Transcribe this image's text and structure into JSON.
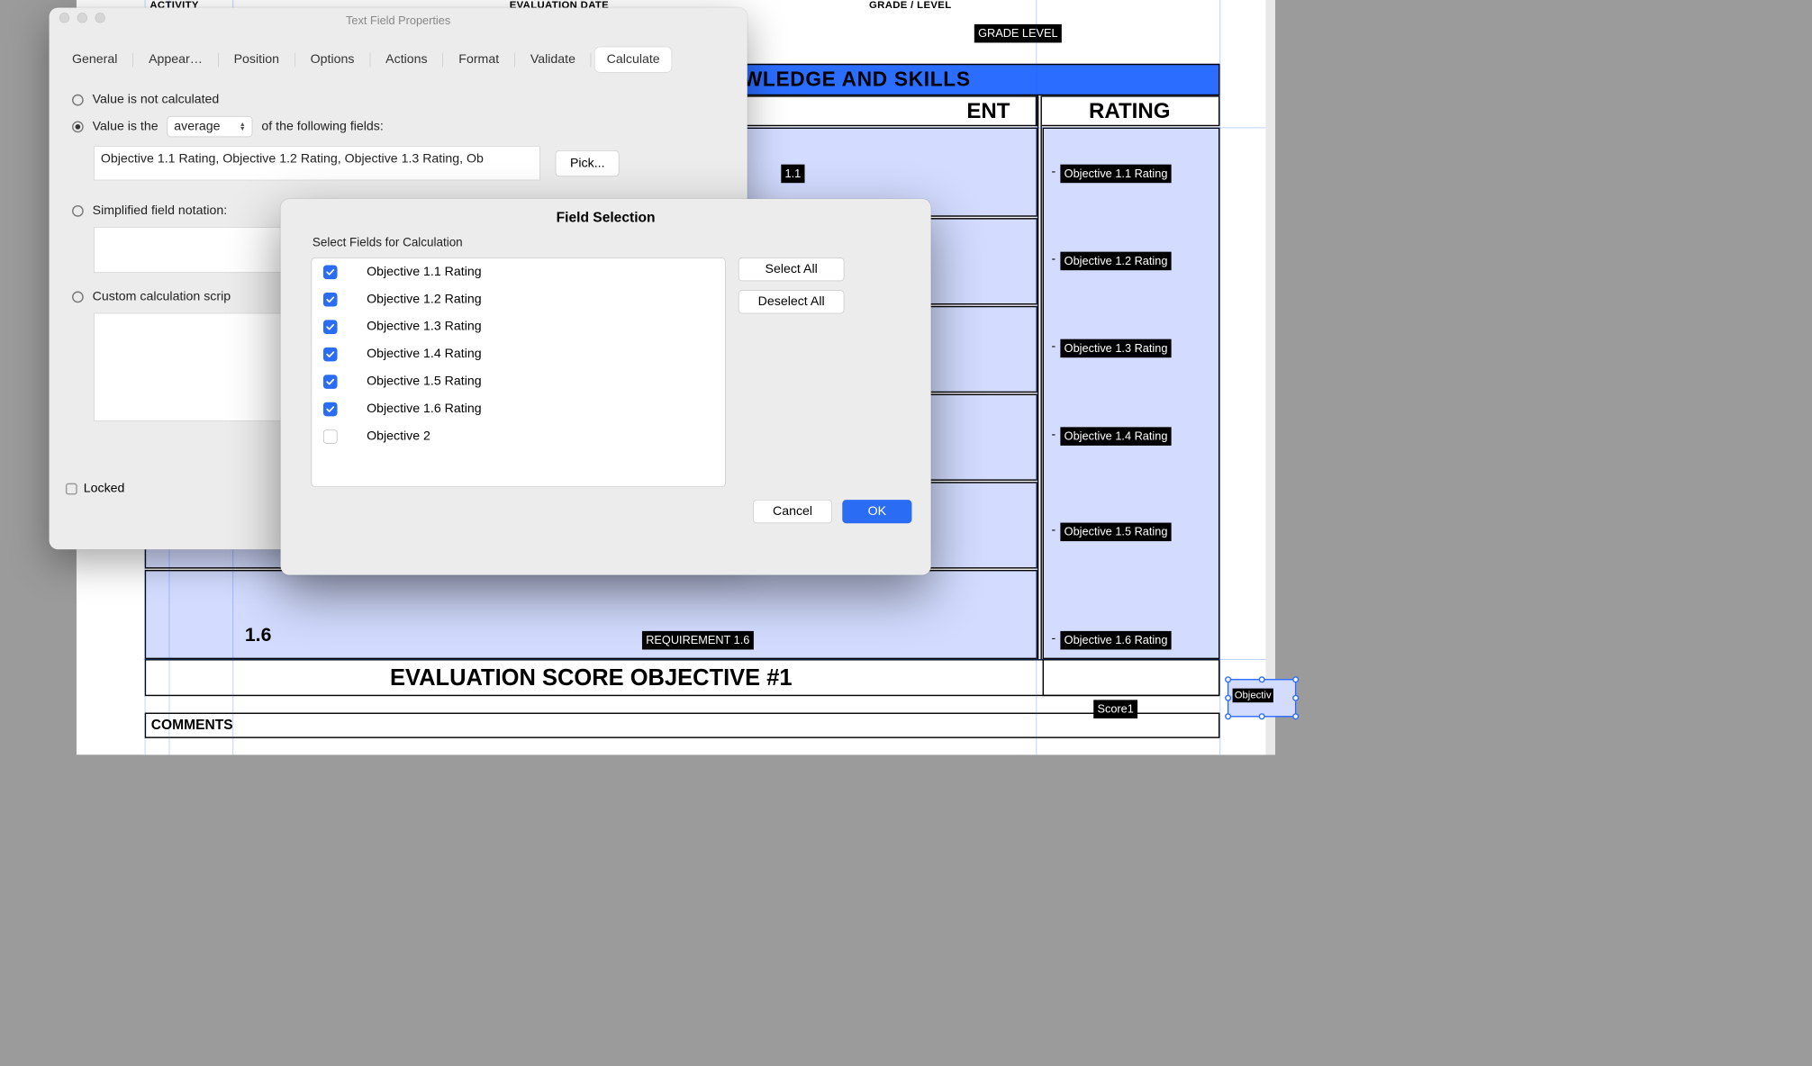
{
  "pdf": {
    "headers": {
      "activity": "ACTIVITY",
      "evaldate": "EVALUATION DATE",
      "grade": "GRADE / LEVEL"
    },
    "chip_grade": "GRADE  LEVEL",
    "blue_hdr": "WLEDGE AND SKILLS",
    "sub_left": "ENT",
    "rating": "RATING",
    "n16": "1.6",
    "req11": "1.1",
    "req16": "REQUIREMENT 1.6",
    "obj_chips": [
      "Objective 1.1 Rating",
      "Objective 1.2 Rating",
      "Objective 1.3 Rating",
      "Objective 1.4 Rating",
      "Objective 1.5 Rating",
      "Objective 1.6 Rating"
    ],
    "eval_score": "EVALUATION SCORE OBJECTIVE #1",
    "score1": "Score1",
    "sel_chip": "Objectiv",
    "comments": "COMMENTS"
  },
  "props": {
    "title": "Text Field Properties",
    "tabs": [
      "General",
      "Appear…",
      "Position",
      "Options",
      "Actions",
      "Format",
      "Validate",
      "Calculate"
    ],
    "active_tab": "Calculate",
    "opt_not_calc": "Value is not calculated",
    "opt_value_is": "Value is the",
    "agg": "average",
    "of_following": "of the following fields:",
    "fields_text": "Objective 1.1 Rating, Objective 1.2 Rating, Objective 1.3 Rating, Ob",
    "pick": "Pick...",
    "simplified": "Simplified field notation:",
    "custom": "Custom calculation scrip",
    "locked": "Locked"
  },
  "fs": {
    "title": "Field Selection",
    "sub": "Select Fields for Calculation",
    "select_all": "Select All",
    "deselect_all": "Deselect All",
    "ok": "OK",
    "cancel": "Cancel",
    "items": [
      {
        "label": "Objective 1.1 Rating",
        "checked": true
      },
      {
        "label": "Objective 1.2 Rating",
        "checked": true
      },
      {
        "label": "Objective 1.3 Rating",
        "checked": true
      },
      {
        "label": "Objective 1.4 Rating",
        "checked": true
      },
      {
        "label": "Objective 1.5 Rating",
        "checked": true
      },
      {
        "label": "Objective 1.6 Rating",
        "checked": true
      },
      {
        "label": "Objective 2",
        "checked": false
      }
    ]
  }
}
